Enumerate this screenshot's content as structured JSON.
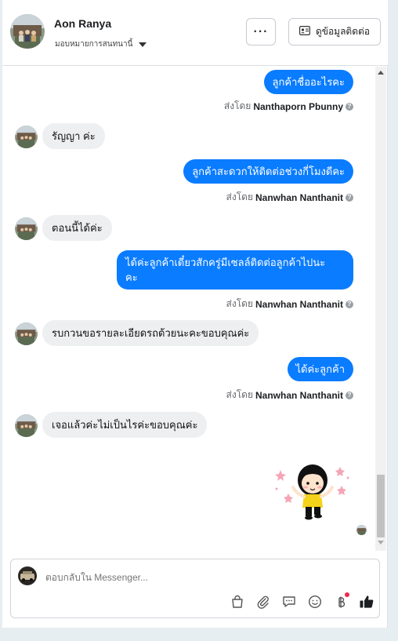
{
  "header": {
    "name": "Aon Ranya",
    "assign_label": "มอบหมายการสนทนานี้",
    "more_label": "···",
    "contact_label": "ดูข้อมูลติดต่อ"
  },
  "messages": [
    {
      "dir": "out",
      "text": "ลูกค้าชื่ออะไรคะ"
    },
    {
      "dir": "sender",
      "prefix": "ส่งโดย",
      "name": "Nanthaporn Pbunny"
    },
    {
      "dir": "in",
      "text": "รัญญา ค่ะ"
    },
    {
      "dir": "out",
      "text": "ลูกค้าสะดวกให้ติดต่อช่วงกี่โมงดีคะ"
    },
    {
      "dir": "sender",
      "prefix": "ส่งโดย",
      "name": "Nanwhan Nanthanit"
    },
    {
      "dir": "in",
      "text": "ตอนนี้ได้ค่ะ"
    },
    {
      "dir": "out",
      "line1": "ได้ค่ะลูกค้าเดี๋ยวสักครู่มีเซลล์ติดต่อลูกค้าไปนะ",
      "line2": "คะ"
    },
    {
      "dir": "sender",
      "prefix": "ส่งโดย",
      "name": "Nanwhan Nanthanit"
    },
    {
      "dir": "in",
      "text": "รบกวนขอรายละเอียดรถด้วยนะคะขอบคุณค่ะ"
    },
    {
      "dir": "out",
      "text": "ได้ค่ะลูกค้า"
    },
    {
      "dir": "sender",
      "prefix": "ส่งโดย",
      "name": "Nanwhan Nanthanit"
    },
    {
      "dir": "in",
      "text": "เจอแล้วค่ะไม่เป็นไรค่ะขอบคุณค่ะ"
    }
  ],
  "composer": {
    "placeholder": "ตอบกลับใน Messenger...",
    "icons": [
      "shopping-bag-icon",
      "paperclip-icon",
      "saved-reply-icon",
      "emoji-icon",
      "baht-icon",
      "thumbs-up-icon"
    ]
  },
  "colors": {
    "outgoing_bubble": "#0a7cff",
    "incoming_bubble": "#eeeff1",
    "thumbs_up": "#1c1e21",
    "notification_dot": "#f02849"
  }
}
